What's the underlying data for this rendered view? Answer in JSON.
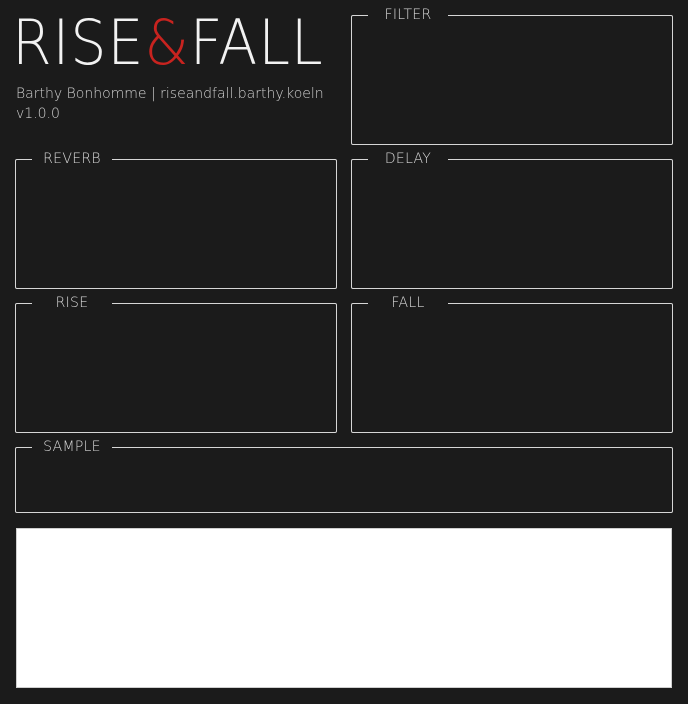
{
  "header": {
    "title_part1": "RISE",
    "title_amp": "&",
    "title_part2": "FALL",
    "author_line": "Barthy Bonhomme | riseandfall.barthy.koeln",
    "version": "v1.0.0"
  },
  "groups": {
    "filter": "FILTER",
    "reverb": "REVERB",
    "delay": "DELAY",
    "rise": "RISE",
    "fall": "FALL",
    "sample": "SAMPLE"
  },
  "colors": {
    "background": "#1b1b1b",
    "accent": "#c8231f",
    "border": "#d6d6d6",
    "waveform_bg": "#ffffff"
  }
}
